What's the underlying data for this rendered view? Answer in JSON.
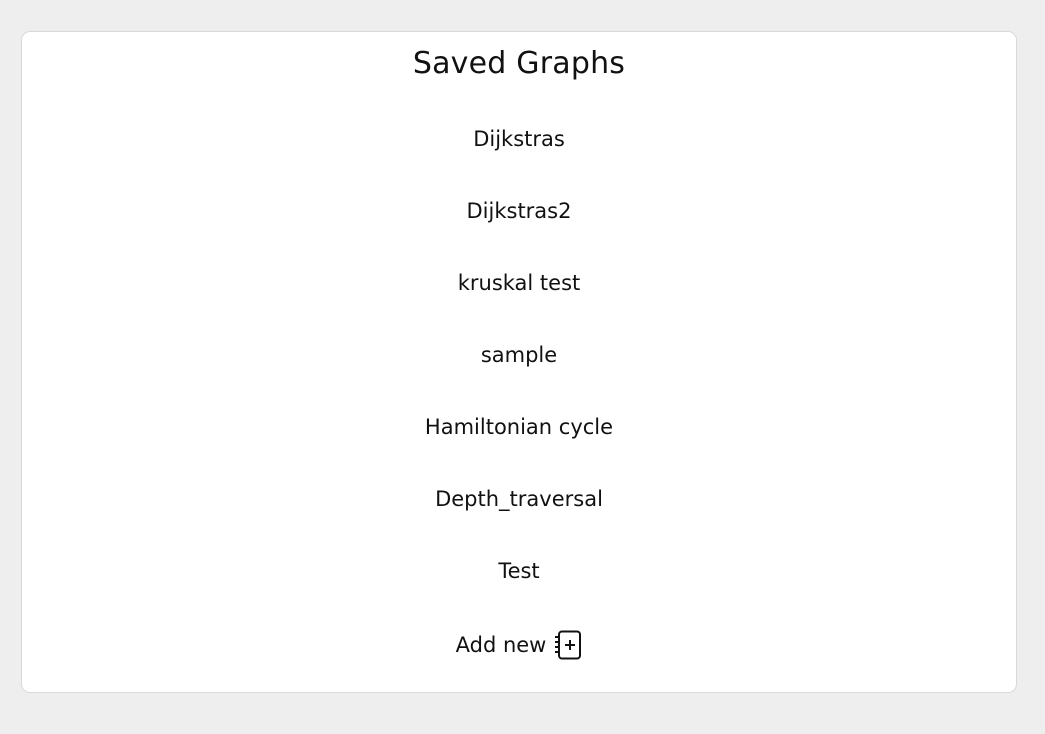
{
  "title": "Saved Graphs",
  "graphs": [
    {
      "label": "Dijkstras"
    },
    {
      "label": "Dijkstras2"
    },
    {
      "label": "kruskal test"
    },
    {
      "label": "sample"
    },
    {
      "label": "Hamiltonian cycle"
    },
    {
      "label": "Depth_traversal"
    },
    {
      "label": "Test"
    }
  ],
  "add_new": {
    "label": "Add new",
    "icon": "notebook-add-icon"
  },
  "colors": {
    "background": "#eeeeee",
    "card": "#ffffff",
    "text": "#111111"
  }
}
